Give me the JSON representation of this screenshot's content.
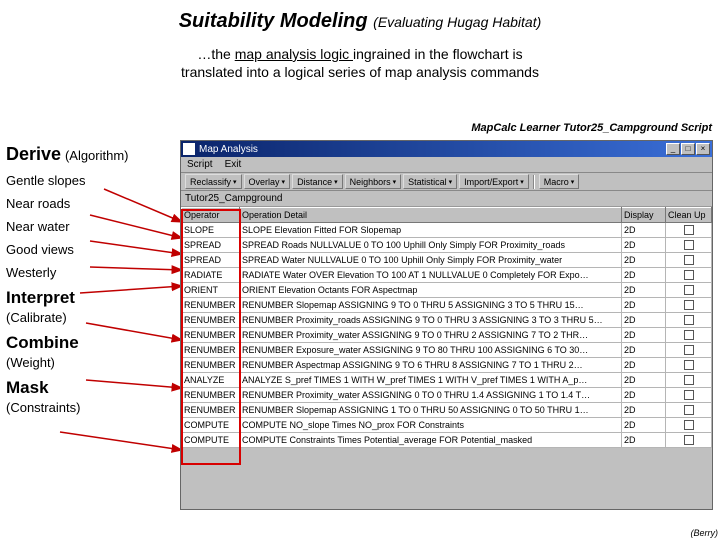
{
  "title_main": "Suitability Modeling",
  "title_sub": "(Evaluating Hugag Habitat)",
  "intro_prefix": "…the ",
  "intro_underlined": "map analysis logic ",
  "intro_rest1": "ingrained in the flowchart is",
  "intro_rest2": "translated into a logical series of map analysis commands",
  "script_label": "MapCalc Learner Tutor25_Campground Script",
  "derive_label": "Derive",
  "derive_sub": "(Algorithm)",
  "criteria": {
    "gentle": "Gentle slopes",
    "roads": "Near roads",
    "water": "Near water",
    "views": "Good views",
    "westerly": "Westerly"
  },
  "interpret_label": "Interpret",
  "interpret_sub": "(Calibrate)",
  "combine_label": "Combine",
  "combine_sub": "(Weight)",
  "mask_label": "Mask",
  "mask_sub": "(Constraints)",
  "footer": "(Berry)",
  "window": {
    "title": "Map Analysis",
    "menu": {
      "script": "Script",
      "exit": "Exit"
    },
    "toolbar": {
      "reclassify": "Reclassify",
      "overlay": "Overlay",
      "distance": "Distance",
      "neighbors": "Neighbors",
      "statistical": "Statistical",
      "importexport": "Import/Export",
      "macro": "Macro"
    },
    "script_name": "Tutor25_Campground",
    "columns": {
      "op": "Operator",
      "detail": "Operation Detail",
      "disp": "Display",
      "clean": "Clean Up"
    },
    "rows": [
      {
        "op": "SLOPE",
        "detail": "SLOPE Elevation Fitted FOR Slopemap",
        "disp": "2D"
      },
      {
        "op": "SPREAD",
        "detail": "SPREAD Roads NULLVALUE 0 TO 100 Uphill Only Simply FOR Proximity_roads",
        "disp": "2D"
      },
      {
        "op": "SPREAD",
        "detail": "SPREAD Water NULLVALUE 0 TO 100 Uphill Only Simply FOR Proximity_water",
        "disp": "2D"
      },
      {
        "op": "RADIATE",
        "detail": "RADIATE Water OVER Elevation TO 100 AT 1 NULLVALUE 0 Completely FOR Expo…",
        "disp": "2D"
      },
      {
        "op": "ORIENT",
        "detail": "ORIENT Elevation Octants FOR Aspectmap",
        "disp": "2D"
      },
      {
        "op": "RENUMBER",
        "detail": "RENUMBER Slopemap ASSIGNING 9 TO 0 THRU 5 ASSIGNING 3 TO 5 THRU 15…",
        "disp": "2D"
      },
      {
        "op": "RENUMBER",
        "detail": "RENUMBER Proximity_roads ASSIGNING 9 TO 0 THRU 3 ASSIGNING 3 TO 3 THRU 5…",
        "disp": "2D"
      },
      {
        "op": "RENUMBER",
        "detail": "RENUMBER Proximity_water ASSIGNING 9 TO 0 THRU 2 ASSIGNING 7 TO 2 THR…",
        "disp": "2D"
      },
      {
        "op": "RENUMBER",
        "detail": "RENUMBER Exposure_water ASSIGNING 9 TO 80 THRU 100 ASSIGNING 6 TO 30…",
        "disp": "2D"
      },
      {
        "op": "RENUMBER",
        "detail": "RENUMBER Aspectmap ASSIGNING 9 TO 6 THRU 8 ASSIGNING 7 TO 1 THRU 2…",
        "disp": "2D"
      },
      {
        "op": "ANALYZE",
        "detail": "ANALYZE S_pref TIMES 1 WITH W_pref TIMES 1 WITH V_pref TIMES 1 WITH A_p…",
        "disp": "2D"
      },
      {
        "op": "RENUMBER",
        "detail": "RENUMBER Proximity_water ASSIGNING 0 TO 0 THRU 1.4 ASSIGNING 1 TO 1.4 T…",
        "disp": "2D"
      },
      {
        "op": "RENUMBER",
        "detail": "RENUMBER Slopemap ASSIGNING 1 TO 0 THRU 50 ASSIGNING 0 TO 50 THRU 1…",
        "disp": "2D"
      },
      {
        "op": "COMPUTE",
        "detail": "COMPUTE NO_slope Times NO_prox FOR Constraints",
        "disp": "2D"
      },
      {
        "op": "COMPUTE",
        "detail": "COMPUTE Constraints Times Potential_average FOR Potential_masked",
        "disp": "2D"
      }
    ]
  }
}
